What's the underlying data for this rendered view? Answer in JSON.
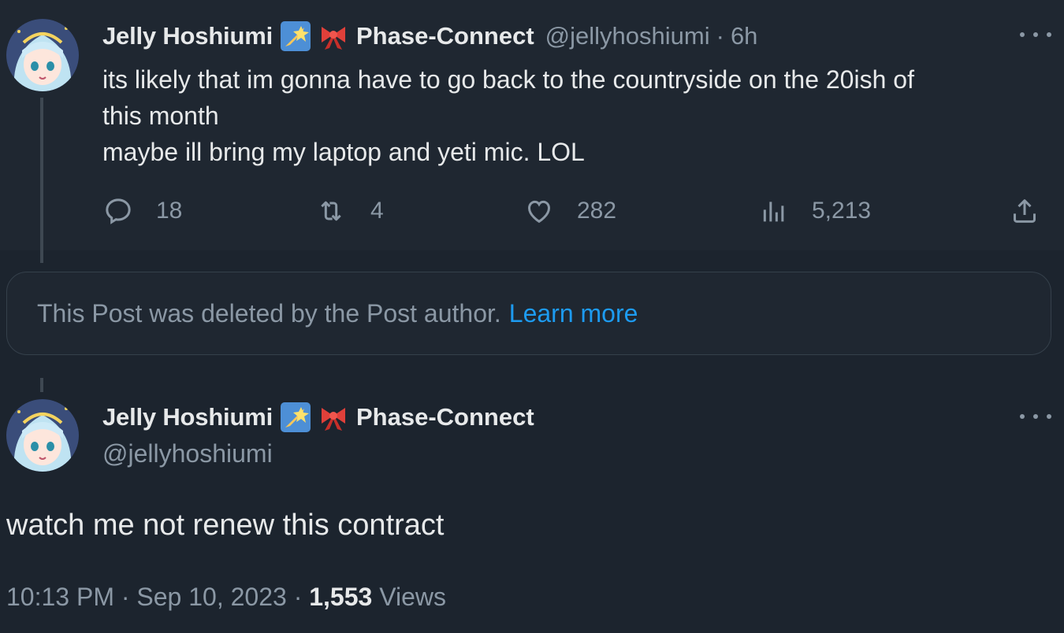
{
  "tweet1": {
    "author_name": "Jelly Hoshiumi",
    "affiliation": "Phase-Connect",
    "handle": "@jellyhoshiumi",
    "separator": "·",
    "time": "6h",
    "text_lines": [
      "its likely that im gonna have to go back to the countryside on the 20ish of",
      "this month",
      "maybe ill bring my laptop and yeti mic. LOL"
    ],
    "actions": {
      "reply_count": "18",
      "repost_count": "4",
      "like_count": "282",
      "views_count": "5,213"
    },
    "icons": [
      "reply-icon",
      "repost-icon",
      "like-icon",
      "views-icon",
      "share-icon",
      "more-icon"
    ]
  },
  "deleted_notice": {
    "text": "This Post was deleted by the Post author.",
    "link": "Learn more"
  },
  "tweet2": {
    "author_name": "Jelly Hoshiumi",
    "affiliation": "Phase-Connect",
    "handle": "@jellyhoshiumi",
    "text": "watch me not renew this contract",
    "time": "10:13 PM",
    "separator": "·",
    "date": "Sep 10, 2023",
    "views_count": "1,553",
    "views_label": "Views"
  },
  "colors": {
    "background": "#1c242e",
    "tweet_highlight": "#1f2731",
    "text_primary": "#e7e9ea",
    "text_secondary": "#8b98a5",
    "link": "#1d9bf0"
  }
}
